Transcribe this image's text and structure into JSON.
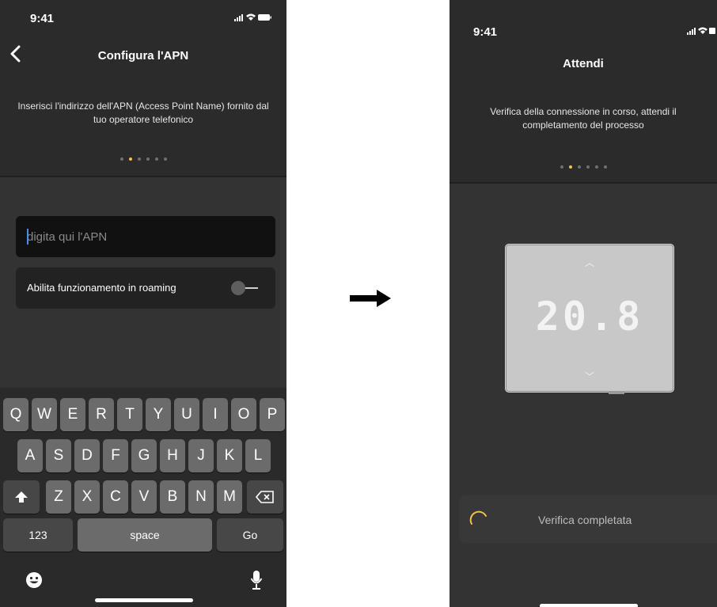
{
  "left_screen": {
    "status_time": "9:41",
    "status_icons": "..ıl ᯤ ▬",
    "title": "Configura l'APN",
    "subtitle": "Inserisci l'indirizzo dell'APN (Access Point Name) fornito dal tuo operatore telefonico",
    "apn_input": {
      "value": "",
      "placeholder": "digita qui l'APN"
    },
    "roaming_label": "Abilita funzionamento in roaming",
    "roaming_toggle_on": false,
    "keyboard": {
      "row1": [
        "Q",
        "W",
        "E",
        "R",
        "T",
        "Y",
        "U",
        "I",
        "O",
        "P"
      ],
      "row2": [
        "A",
        "S",
        "D",
        "F",
        "G",
        "H",
        "J",
        "K",
        "L"
      ],
      "row3": [
        "Z",
        "X",
        "C",
        "V",
        "B",
        "N",
        "M"
      ],
      "numbers_key": "123",
      "space_key": "space",
      "go_key": "Go"
    }
  },
  "right_screen": {
    "status_time": "9:41",
    "status_icons": "..ıl ᯤ ▬",
    "title": "Attendi",
    "subtitle": "Verifica della connessione in corso, attendi il completamento del processo",
    "thermostat_display": "20.8",
    "progress_text": "Verifica completata"
  },
  "colors": {
    "accent_dot": "#f2c14e",
    "spinner": "#f2c14e",
    "background": "#2b2b2b"
  }
}
